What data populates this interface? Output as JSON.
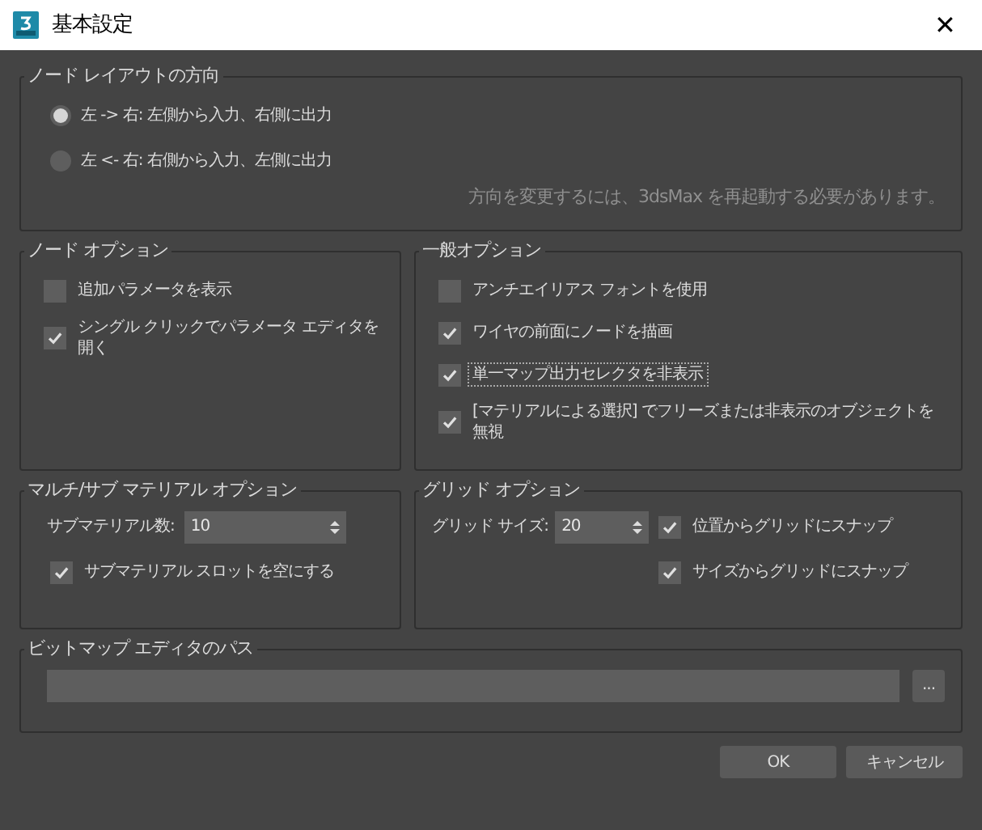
{
  "window": {
    "title": "基本設定",
    "close": "✕"
  },
  "layout_group": {
    "title": "ノード レイアウトの方向",
    "options": [
      {
        "label": "左 -> 右: 左側から入力、右側に出力",
        "selected": true
      },
      {
        "label": "左 <- 右: 右側から入力、左側に出力",
        "selected": false
      }
    ],
    "note": "方向を変更するには、3dsMax を再起動する必要があります。"
  },
  "node_options": {
    "title": "ノード オプション",
    "items": [
      {
        "label": "追加パラメータを表示",
        "checked": false
      },
      {
        "label": "シングル クリックでパラメータ エディタを開く",
        "checked": true
      }
    ]
  },
  "general_options": {
    "title": "一般オプション",
    "items": [
      {
        "label": "アンチエイリアス フォントを使用",
        "checked": false,
        "focused": false
      },
      {
        "label": "ワイヤの前面にノードを描画",
        "checked": true,
        "focused": false
      },
      {
        "label": "単一マップ出力セレクタを非表示",
        "checked": true,
        "focused": true
      },
      {
        "label": "[マテリアルによる選択] でフリーズまたは非表示のオブジェクトを無視",
        "checked": true,
        "focused": false
      }
    ]
  },
  "multisub": {
    "title": "マルチ/サブ マテリアル オプション",
    "count_label": "サブマテリアル数:",
    "count_value": "10",
    "items": [
      {
        "label": "サブマテリアル スロットを空にする",
        "checked": true
      }
    ]
  },
  "grid": {
    "title": "グリッド オプション",
    "size_label": "グリッド サイズ:",
    "size_value": "20",
    "items": [
      {
        "label": "位置からグリッドにスナップ",
        "checked": true
      },
      {
        "label": "サイズからグリッドにスナップ",
        "checked": true
      }
    ]
  },
  "bitmap": {
    "title": "ビットマップ エディタのパス",
    "browse": "..."
  },
  "buttons": [
    "OK",
    "キャンセル"
  ]
}
